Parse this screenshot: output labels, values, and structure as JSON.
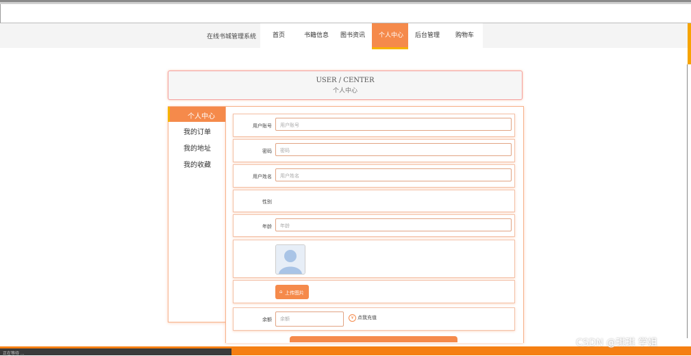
{
  "nav": {
    "site_title": "在线书城管理系统",
    "items": [
      "首页",
      "书籍信息",
      "图书资讯",
      "个人中心",
      "后台管理",
      "购物车"
    ],
    "active_index": 3
  },
  "header": {
    "title_en": "USER / CENTER",
    "title_zh": "个人中心"
  },
  "sidebar": {
    "items": [
      "个人中心",
      "我的订单",
      "我的地址",
      "我的收藏"
    ]
  },
  "form": {
    "account": {
      "label": "用户账号",
      "placeholder": "用户账号"
    },
    "password": {
      "label": "密码",
      "placeholder": "密码"
    },
    "username": {
      "label": "用户姓名",
      "placeholder": "用户姓名"
    },
    "gender": {
      "label": "性别"
    },
    "age": {
      "label": "年龄",
      "placeholder": "年龄"
    },
    "upload": {
      "label": "上传图片"
    },
    "balance": {
      "label": "余额",
      "placeholder": "余额",
      "recharge": "点我充值"
    }
  },
  "status_bar": {
    "text": "正在等待 ..."
  },
  "watermark": "CSDN @琪琪 学姐",
  "colors": {
    "accent": "#f58a4b",
    "accent_yellow": "#f6b400",
    "bottom_bar": "#f57f12"
  }
}
